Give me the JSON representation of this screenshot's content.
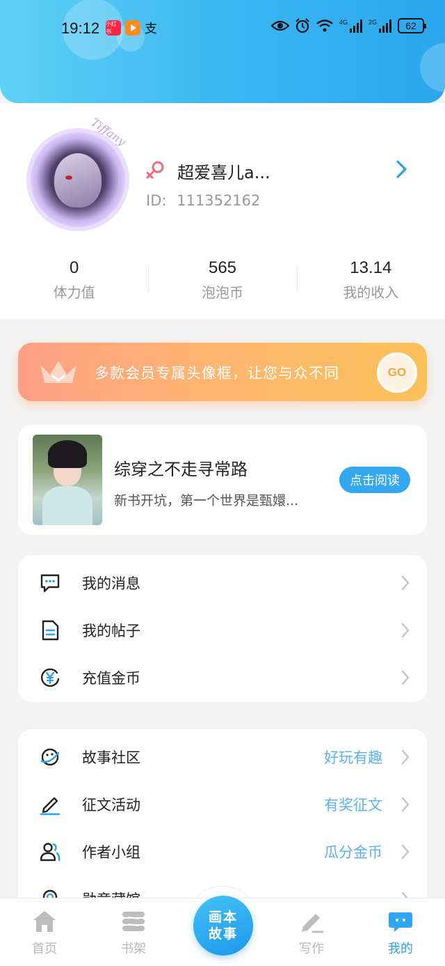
{
  "status_bar": {
    "time": "19:12",
    "apps": [
      "小红书",
      "",
      "支"
    ],
    "battery": "62",
    "network": [
      "4G",
      "2G"
    ]
  },
  "profile": {
    "nickname": "超爱喜儿a...",
    "id_label": "ID:",
    "id_value": "111352162",
    "gender_icon": "female-icon",
    "avatar_text": "Tiffany"
  },
  "stats": [
    {
      "value": "0",
      "label": "体力值"
    },
    {
      "value": "565",
      "label": "泡泡币"
    },
    {
      "value": "13.14",
      "label": "我的收入"
    }
  ],
  "vip_banner": {
    "text": "多款会员专属头像框，让您与众不同",
    "go_label": "GO"
  },
  "book": {
    "title": "综穿之不走寻常路",
    "description": "新书开坑，第一个世界是甄嬛...",
    "button_label": "点击阅读"
  },
  "menu_group_1": [
    {
      "label": "我的消息",
      "icon": "message-icon"
    },
    {
      "label": "我的帖子",
      "icon": "document-icon"
    },
    {
      "label": "充值金币",
      "icon": "yen-coin-icon"
    }
  ],
  "menu_group_2": [
    {
      "label": "故事社区",
      "extra": "好玩有趣",
      "icon": "planet-icon"
    },
    {
      "label": "征文活动",
      "extra": "有奖征文",
      "icon": "pen-icon"
    },
    {
      "label": "作者小组",
      "extra": "瓜分金币",
      "icon": "group-icon"
    },
    {
      "label": "勋章藏馆",
      "extra": "",
      "icon": "medal-icon"
    }
  ],
  "tabbar": {
    "tabs": [
      {
        "label": "首页",
        "icon": "home-icon"
      },
      {
        "label": "书架",
        "icon": "bookshelf-icon"
      },
      {
        "label": "写作",
        "icon": "write-icon"
      },
      {
        "label": "我的",
        "icon": "profile-chat-icon"
      }
    ],
    "center_label": "画本故事",
    "active": "我的"
  },
  "colors": {
    "accent": "#2a9ff0",
    "vip_start": "#ff9f86",
    "vip_end": "#fbc15a",
    "extra_text": "#5ab2f0"
  }
}
